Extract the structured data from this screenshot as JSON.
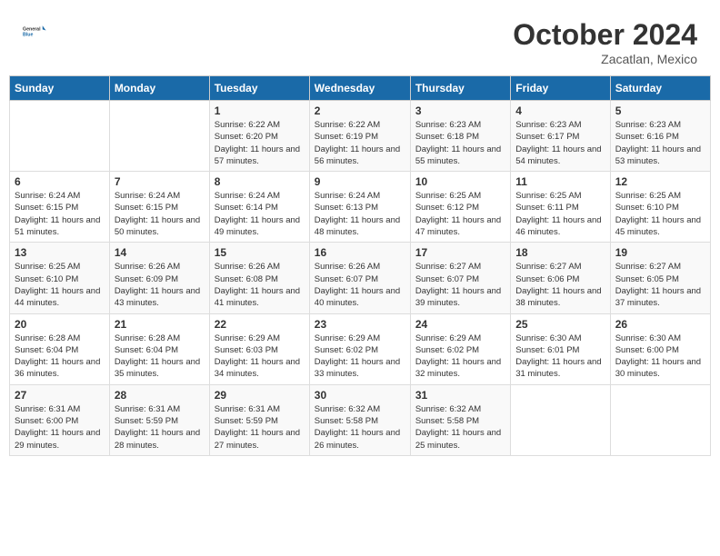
{
  "header": {
    "logo_line1": "General",
    "logo_line2": "Blue",
    "month": "October 2024",
    "location": "Zacatlan, Mexico"
  },
  "days_of_week": [
    "Sunday",
    "Monday",
    "Tuesday",
    "Wednesday",
    "Thursday",
    "Friday",
    "Saturday"
  ],
  "weeks": [
    [
      {
        "day": "",
        "info": ""
      },
      {
        "day": "",
        "info": ""
      },
      {
        "day": "1",
        "info": "Sunrise: 6:22 AM\nSunset: 6:20 PM\nDaylight: 11 hours and 57 minutes."
      },
      {
        "day": "2",
        "info": "Sunrise: 6:22 AM\nSunset: 6:19 PM\nDaylight: 11 hours and 56 minutes."
      },
      {
        "day": "3",
        "info": "Sunrise: 6:23 AM\nSunset: 6:18 PM\nDaylight: 11 hours and 55 minutes."
      },
      {
        "day": "4",
        "info": "Sunrise: 6:23 AM\nSunset: 6:17 PM\nDaylight: 11 hours and 54 minutes."
      },
      {
        "day": "5",
        "info": "Sunrise: 6:23 AM\nSunset: 6:16 PM\nDaylight: 11 hours and 53 minutes."
      }
    ],
    [
      {
        "day": "6",
        "info": "Sunrise: 6:24 AM\nSunset: 6:15 PM\nDaylight: 11 hours and 51 minutes."
      },
      {
        "day": "7",
        "info": "Sunrise: 6:24 AM\nSunset: 6:15 PM\nDaylight: 11 hours and 50 minutes."
      },
      {
        "day": "8",
        "info": "Sunrise: 6:24 AM\nSunset: 6:14 PM\nDaylight: 11 hours and 49 minutes."
      },
      {
        "day": "9",
        "info": "Sunrise: 6:24 AM\nSunset: 6:13 PM\nDaylight: 11 hours and 48 minutes."
      },
      {
        "day": "10",
        "info": "Sunrise: 6:25 AM\nSunset: 6:12 PM\nDaylight: 11 hours and 47 minutes."
      },
      {
        "day": "11",
        "info": "Sunrise: 6:25 AM\nSunset: 6:11 PM\nDaylight: 11 hours and 46 minutes."
      },
      {
        "day": "12",
        "info": "Sunrise: 6:25 AM\nSunset: 6:10 PM\nDaylight: 11 hours and 45 minutes."
      }
    ],
    [
      {
        "day": "13",
        "info": "Sunrise: 6:25 AM\nSunset: 6:10 PM\nDaylight: 11 hours and 44 minutes."
      },
      {
        "day": "14",
        "info": "Sunrise: 6:26 AM\nSunset: 6:09 PM\nDaylight: 11 hours and 43 minutes."
      },
      {
        "day": "15",
        "info": "Sunrise: 6:26 AM\nSunset: 6:08 PM\nDaylight: 11 hours and 41 minutes."
      },
      {
        "day": "16",
        "info": "Sunrise: 6:26 AM\nSunset: 6:07 PM\nDaylight: 11 hours and 40 minutes."
      },
      {
        "day": "17",
        "info": "Sunrise: 6:27 AM\nSunset: 6:07 PM\nDaylight: 11 hours and 39 minutes."
      },
      {
        "day": "18",
        "info": "Sunrise: 6:27 AM\nSunset: 6:06 PM\nDaylight: 11 hours and 38 minutes."
      },
      {
        "day": "19",
        "info": "Sunrise: 6:27 AM\nSunset: 6:05 PM\nDaylight: 11 hours and 37 minutes."
      }
    ],
    [
      {
        "day": "20",
        "info": "Sunrise: 6:28 AM\nSunset: 6:04 PM\nDaylight: 11 hours and 36 minutes."
      },
      {
        "day": "21",
        "info": "Sunrise: 6:28 AM\nSunset: 6:04 PM\nDaylight: 11 hours and 35 minutes."
      },
      {
        "day": "22",
        "info": "Sunrise: 6:29 AM\nSunset: 6:03 PM\nDaylight: 11 hours and 34 minutes."
      },
      {
        "day": "23",
        "info": "Sunrise: 6:29 AM\nSunset: 6:02 PM\nDaylight: 11 hours and 33 minutes."
      },
      {
        "day": "24",
        "info": "Sunrise: 6:29 AM\nSunset: 6:02 PM\nDaylight: 11 hours and 32 minutes."
      },
      {
        "day": "25",
        "info": "Sunrise: 6:30 AM\nSunset: 6:01 PM\nDaylight: 11 hours and 31 minutes."
      },
      {
        "day": "26",
        "info": "Sunrise: 6:30 AM\nSunset: 6:00 PM\nDaylight: 11 hours and 30 minutes."
      }
    ],
    [
      {
        "day": "27",
        "info": "Sunrise: 6:31 AM\nSunset: 6:00 PM\nDaylight: 11 hours and 29 minutes."
      },
      {
        "day": "28",
        "info": "Sunrise: 6:31 AM\nSunset: 5:59 PM\nDaylight: 11 hours and 28 minutes."
      },
      {
        "day": "29",
        "info": "Sunrise: 6:31 AM\nSunset: 5:59 PM\nDaylight: 11 hours and 27 minutes."
      },
      {
        "day": "30",
        "info": "Sunrise: 6:32 AM\nSunset: 5:58 PM\nDaylight: 11 hours and 26 minutes."
      },
      {
        "day": "31",
        "info": "Sunrise: 6:32 AM\nSunset: 5:58 PM\nDaylight: 11 hours and 25 minutes."
      },
      {
        "day": "",
        "info": ""
      },
      {
        "day": "",
        "info": ""
      }
    ]
  ]
}
